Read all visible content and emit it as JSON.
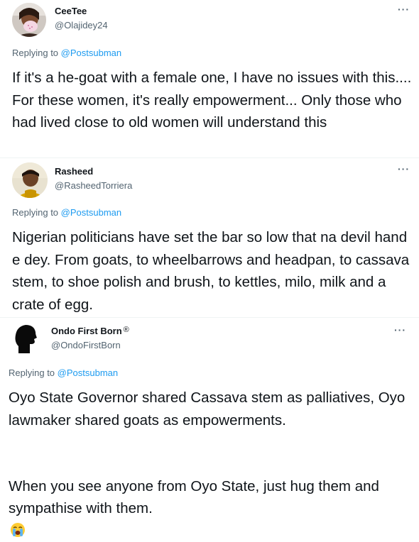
{
  "tweets": [
    {
      "name": "CeeTee",
      "handle": "@Olajidey24",
      "replying_prefix": "Replying to",
      "replying_to": "@Postsubman",
      "text": "If it's a he-goat with a female one, I have no issues with this.... For these women, it's really empowerment... Only those who had lived close to old women will understand this",
      "more_icon": "more-dots-icon"
    },
    {
      "name": "Rasheed",
      "handle": "@RasheedTorriera",
      "replying_prefix": "Replying to",
      "replying_to": "@Postsubman",
      "text": "Nigerian politicians have set the bar so low that na devil hand e dey.  From goats, to wheelbarrows and headpan, to cassava stem, to shoe polish and brush, to kettles, milo, milk and a crate of egg.",
      "more_icon": "more-dots-icon"
    },
    {
      "name": "Ondo First Born",
      "name_badge": "®",
      "handle": "@OndoFirstBorn",
      "replying_prefix": "Replying to",
      "replying_to": "@Postsubman",
      "text_p1": "Oyo State Governor shared Cassava stem as palliatives, Oyo lawmaker shared goats as empowerments.",
      "text_p2": "When you see anyone from Oyo State, just hug them and sympathise with them.",
      "emoji": "loudly-crying-face",
      "more_icon": "more-dots-icon"
    }
  ],
  "colors": {
    "text": "#0f1419",
    "secondary": "#536471",
    "link": "#1d9bf0",
    "divider": "#eff3f4"
  }
}
